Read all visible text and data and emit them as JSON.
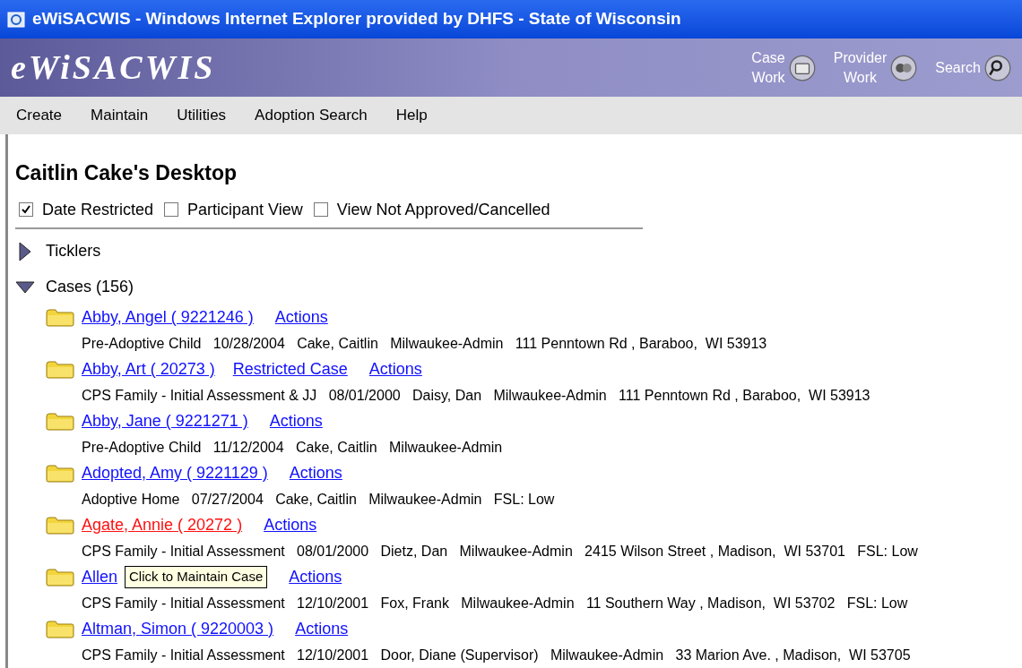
{
  "window": {
    "title": "eWiSACWIS - Windows Internet Explorer provided by DHFS - State of Wisconsin"
  },
  "header": {
    "logo": "eWiSACWIS",
    "nav": [
      {
        "kind": "casework",
        "line1": "Case",
        "line2": "Work"
      },
      {
        "kind": "provider",
        "line1": "Provider",
        "line2": "Work"
      },
      {
        "kind": "search",
        "line1": "Search"
      }
    ]
  },
  "menu": [
    "Create",
    "Maintain",
    "Utilities",
    "Adoption Search",
    "Help"
  ],
  "page_title": "Caitlin Cake's Desktop",
  "filters": [
    {
      "label": "Date Restricted",
      "checked": true
    },
    {
      "label": "Participant View",
      "checked": false
    },
    {
      "label": "View Not Approved/Cancelled",
      "checked": false
    }
  ],
  "sections": [
    {
      "label": "Ticklers",
      "expanded": false
    },
    {
      "label": "Cases (156)",
      "expanded": true
    }
  ],
  "cases": [
    {
      "name": "Abby, Angel ( 9221246 )",
      "alert": false,
      "action": "Actions",
      "info": "Pre-Adoptive Child   10/28/2004   Cake, Caitlin   Milwaukee-Admin   111 Penntown Rd , Baraboo,  WI 53913"
    },
    {
      "name": "Abby, Art ( 20273 )",
      "alert": false,
      "restricted_label": "Restricted Case",
      "action": "Actions",
      "info": "CPS Family - Initial Assessment & JJ   08/01/2000   Daisy, Dan   Milwaukee-Admin   111 Penntown Rd , Baraboo,  WI 53913"
    },
    {
      "name": "Abby, Jane ( 9221271 )",
      "alert": false,
      "action": "Actions",
      "info": "Pre-Adoptive Child   11/12/2004   Cake, Caitlin   Milwaukee-Admin"
    },
    {
      "name": "Adopted, Amy ( 9221129 )",
      "alert": false,
      "action": "Actions",
      "info": "Adoptive Home   07/27/2004   Cake, Caitlin   Milwaukee-Admin   FSL: Low"
    },
    {
      "name": "Agate, Annie ( 20272 )",
      "alert": true,
      "action": "Actions",
      "info": "CPS Family - Initial Assessment   08/01/2000   Dietz, Dan   Milwaukee-Admin   2415 Wilson Street , Madison,  WI 53701   FSL: Low"
    },
    {
      "name": "Allen",
      "alert": false,
      "tooltip": "Click to Maintain Case",
      "action": "Actions",
      "info": "CPS Family - Initial Assessment   12/10/2001   Fox, Frank   Milwaukee-Admin   11 Southern Way , Madison,  WI 53702   FSL: Low"
    },
    {
      "name": "Altman, Simon ( 9220003 )",
      "alert": false,
      "action": "Actions",
      "info": "CPS Family - Initial Assessment   12/10/2001   Door, Diane (Supervisor)   Milwaukee-Admin   33 Marion Ave. , Madison,  WI 53705"
    }
  ]
}
